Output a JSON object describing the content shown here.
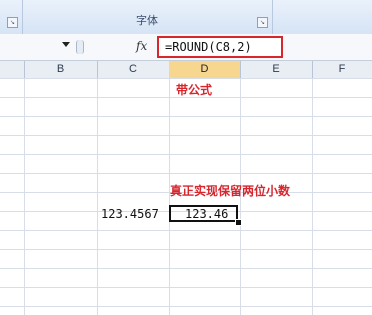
{
  "ribbon": {
    "group_label": "字体"
  },
  "formula_bar": {
    "fx_label": "fx",
    "formula": "=ROUND(C8,2)"
  },
  "columns": [
    "B",
    "C",
    "D",
    "E",
    "F"
  ],
  "active_column": "D",
  "annotations": {
    "with_formula": "带公式",
    "true_rounding": "真正实现保留两位小数"
  },
  "cells": {
    "C8": "123.4567",
    "D8": "123.46"
  },
  "colors": {
    "annotation_red": "#d8262d",
    "highlight_border": "#d8262d"
  }
}
